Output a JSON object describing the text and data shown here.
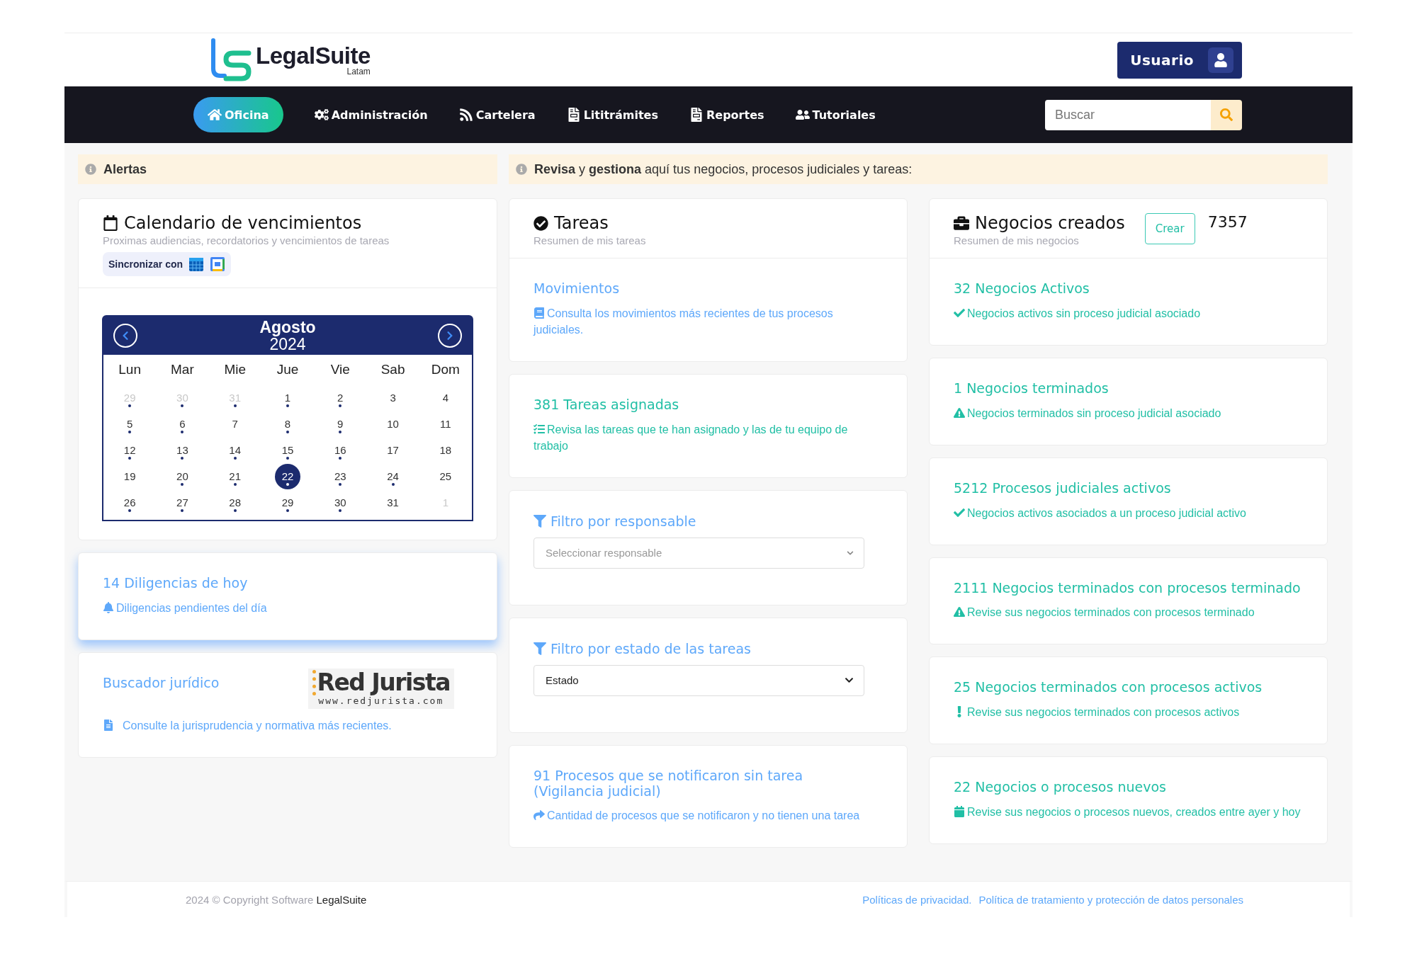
{
  "header": {
    "logo": {
      "name": "LegalSuite",
      "region": "Latam"
    },
    "user_button": "Usuario"
  },
  "nav": {
    "items": [
      {
        "label": "Oficina",
        "selected": true
      },
      {
        "label": "Administración",
        "selected": false
      },
      {
        "label": "Cartelera",
        "selected": false
      },
      {
        "label": "Lititrámites",
        "selected": false
      },
      {
        "label": "Reportes",
        "selected": false
      },
      {
        "label": "Tutoriales",
        "selected": false
      }
    ],
    "search": {
      "placeholder": "Buscar"
    }
  },
  "alerts": {
    "title": "Alertas",
    "message": "**Revisa** y **gestiona** aquí tus negocios, procesos judiciales y tareas:"
  },
  "calendar": {
    "title": "Calendario de vencimientos",
    "subtitle": "Proximas audiencias, recordatorios y vencimientos de tareas",
    "sync_label": "Sincronizar con",
    "month": "Agosto",
    "year": "2024",
    "weekdays": [
      "Lun",
      "Mar",
      "Mie",
      "Jue",
      "Vie",
      "Sab",
      "Dom"
    ],
    "weeks": [
      [
        {
          "day": "29",
          "muted": true,
          "event": true,
          "selected": false
        },
        {
          "day": "30",
          "muted": true,
          "event": true,
          "selected": false
        },
        {
          "day": "31",
          "muted": true,
          "event": true,
          "selected": false
        },
        {
          "day": "1",
          "muted": false,
          "event": true,
          "selected": false
        },
        {
          "day": "2",
          "muted": false,
          "event": true,
          "selected": false
        },
        {
          "day": "3",
          "muted": false,
          "event": false,
          "selected": false
        },
        {
          "day": "4",
          "muted": false,
          "event": false,
          "selected": false
        }
      ],
      [
        {
          "day": "5",
          "muted": false,
          "event": true,
          "selected": false
        },
        {
          "day": "6",
          "muted": false,
          "event": true,
          "selected": false
        },
        {
          "day": "7",
          "muted": false,
          "event": false,
          "selected": false
        },
        {
          "day": "8",
          "muted": false,
          "event": true,
          "selected": false
        },
        {
          "day": "9",
          "muted": false,
          "event": true,
          "selected": false
        },
        {
          "day": "10",
          "muted": false,
          "event": false,
          "selected": false
        },
        {
          "day": "11",
          "muted": false,
          "event": false,
          "selected": false
        }
      ],
      [
        {
          "day": "12",
          "muted": false,
          "event": true,
          "selected": false
        },
        {
          "day": "13",
          "muted": false,
          "event": true,
          "selected": false
        },
        {
          "day": "14",
          "muted": false,
          "event": true,
          "selected": false
        },
        {
          "day": "15",
          "muted": false,
          "event": true,
          "selected": false
        },
        {
          "day": "16",
          "muted": false,
          "event": true,
          "selected": false
        },
        {
          "day": "17",
          "muted": false,
          "event": false,
          "selected": false
        },
        {
          "day": "18",
          "muted": false,
          "event": false,
          "selected": false
        }
      ],
      [
        {
          "day": "19",
          "muted": false,
          "event": false,
          "selected": false
        },
        {
          "day": "20",
          "muted": false,
          "event": true,
          "selected": false
        },
        {
          "day": "21",
          "muted": false,
          "event": true,
          "selected": false
        },
        {
          "day": "22",
          "muted": false,
          "event": true,
          "selected": true
        },
        {
          "day": "23",
          "muted": false,
          "event": true,
          "selected": false
        },
        {
          "day": "24",
          "muted": false,
          "event": true,
          "selected": false
        },
        {
          "day": "25",
          "muted": false,
          "event": false,
          "selected": false
        }
      ],
      [
        {
          "day": "26",
          "muted": false,
          "event": true,
          "selected": false
        },
        {
          "day": "27",
          "muted": false,
          "event": true,
          "selected": false
        },
        {
          "day": "28",
          "muted": false,
          "event": true,
          "selected": false
        },
        {
          "day": "29",
          "muted": false,
          "event": true,
          "selected": false
        },
        {
          "day": "30",
          "muted": false,
          "event": true,
          "selected": false
        },
        {
          "day": "31",
          "muted": false,
          "event": false,
          "selected": false
        },
        {
          "day": "1",
          "muted": true,
          "event": false,
          "selected": false
        }
      ]
    ]
  },
  "today": {
    "title": "14 Diligencias de hoy",
    "description": "Diligencias pendientes del día"
  },
  "legal_search": {
    "title": "Buscador jurídico",
    "logo": {
      "name": "Red Jurista",
      "url": "www.redjurista.com"
    },
    "description": "Consulte la jurisprudencia y normativa más recientes."
  },
  "tasks": {
    "title": "Tareas",
    "subtitle": "Resumen de mis tareas",
    "items": [
      {
        "kind": "info",
        "title": "Movimientos",
        "description": "Consulta los movimientos más recientes de tus procesos judiciales.",
        "color": "#5ea8fa"
      },
      {
        "kind": "info",
        "title": "381 Tareas asignadas",
        "description": "Revisa las tareas que te han asignado y las de tu equipo de trabajo",
        "color": "#21bfa5"
      },
      {
        "kind": "filter",
        "title": "Filtro por responsable",
        "select": {
          "placeholder": "Seleccionar responsable"
        },
        "color": "#5ea8fa"
      },
      {
        "kind": "filter",
        "title": "Filtro por estado de las tareas",
        "select": {
          "value": "Estado"
        },
        "color": "#5ea8fa"
      },
      {
        "kind": "info",
        "title": "91 Procesos que se notificaron sin tarea (Vigilancia judicial)",
        "description": "Cantidad de procesos que se notificaron y no tienen una tarea",
        "color": "#5ea8fa"
      }
    ]
  },
  "business": {
    "title": "Negocios creados",
    "subtitle": "Resumen de mis negocios",
    "button": "Crear",
    "count": "7357",
    "items": [
      {
        "title": "32 Negocios Activos",
        "description": "Negocios activos sin proceso judicial asociado"
      },
      {
        "title": "1 Negocios terminados",
        "description": "Negocios terminados sin proceso judicial asociado"
      },
      {
        "title": "5212 Procesos judiciales activos",
        "description": "Negocios activos asociados a un proceso judicial activo"
      },
      {
        "title": "2111 Negocios terminados con procesos terminado",
        "description": "Revise sus negocios terminados con procesos terminado"
      },
      {
        "title": "25 Negocios terminados con procesos activos",
        "description": "Revise sus negocios terminados con procesos activos"
      },
      {
        "title": "22 Negocios o procesos nuevos",
        "description": "Revise sus negocios o procesos nuevos, creados entre ayer y hoy"
      }
    ]
  },
  "footer": {
    "copyright": "2024 © Copyright Software **LegalSuite**",
    "links": [
      "Políticas de privacidad.",
      "Política de tratamiento y protección de datos personales"
    ]
  }
}
